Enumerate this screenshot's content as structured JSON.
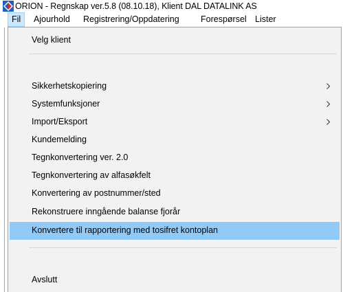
{
  "window": {
    "title": "ORION - Regnskap ver.5.8 (08.10.18), Klient DAL DATALINK AS"
  },
  "colors": {
    "menu_background": "#f2f2f2",
    "selected_item": "#91c9f7",
    "active_menubar_item": "#cce8ff",
    "app_icon_blue": "#1f5fbf",
    "app_icon_red": "#d62b2b"
  },
  "icons": {
    "app": "orion-app-icon",
    "submenu": "chevron-right-icon"
  },
  "menubar": {
    "items": [
      {
        "label": "Fil",
        "active": true
      },
      {
        "label": "Ajourhold"
      },
      {
        "label": "Registrering/Oppdatering"
      },
      {
        "label": "Forespørsel"
      },
      {
        "label": "Lister"
      }
    ]
  },
  "fil_menu": {
    "items": [
      {
        "label": "Velg klient"
      },
      {
        "label": "Sikkerhetskopiering",
        "submenu": true
      },
      {
        "label": "Systemfunksjoner",
        "submenu": true
      },
      {
        "label": "Import/Eksport",
        "submenu": true
      },
      {
        "label": "Kundemelding"
      },
      {
        "label": "Tegnkonvertering ver. 2.0"
      },
      {
        "label": "Tegnkonvertering av alfasøkfelt"
      },
      {
        "label": "Konvertering av postnummer/sted"
      },
      {
        "label": "Rekonstruere inngående balanse fjorår"
      },
      {
        "label": "Konvertere til rapportering med tosifret kontoplan",
        "selected": true
      },
      {
        "label": "Avslutt"
      }
    ]
  }
}
